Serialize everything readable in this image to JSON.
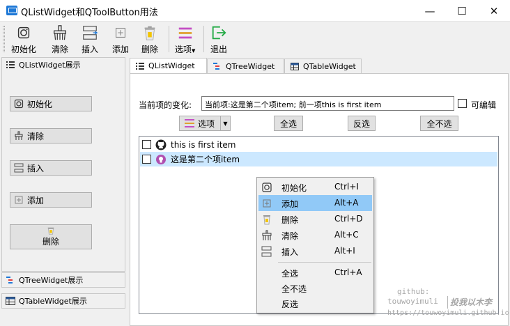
{
  "window": {
    "title": "QListWidget和QToolButton用法",
    "minimize": "—",
    "maximize": "☐",
    "close": "✕"
  },
  "toolbar": {
    "init": "初始化",
    "clear": "清除",
    "insert": "插入",
    "add": "添加",
    "delete": "删除",
    "options": "选项",
    "exit": "退出"
  },
  "dock": {
    "list_title": "QListWidget展示",
    "tree_title": "QTreeWidget展示",
    "table_title": "QTableWidget展示",
    "buttons": {
      "init": "初始化",
      "clear": "清除",
      "insert": "插入",
      "add": "添加",
      "delete": "删除"
    }
  },
  "tabs": [
    {
      "label": "QListWidget"
    },
    {
      "label": "QTreeWidget"
    },
    {
      "label": "QTableWidget"
    }
  ],
  "list_page": {
    "current_label": "当前项的变化:",
    "current_value": "当前项:这是第二个项item;   前一项this is first item",
    "editable_label": "可编辑",
    "options_button": "选项",
    "select_all": "全选",
    "invert": "反选",
    "select_none": "全不选",
    "items": [
      {
        "text": "this is first item",
        "icon": "github-icon",
        "checked": false,
        "selected": false
      },
      {
        "text": "这是第二个项item",
        "icon": "github-purple-icon",
        "checked": false,
        "selected": true
      }
    ]
  },
  "context_menu": {
    "items": [
      {
        "label": "初始化",
        "shortcut": "Ctrl+I",
        "icon": "init-icon"
      },
      {
        "label": "添加",
        "shortcut": "Alt+A",
        "icon": "add-icon",
        "highlighted": true
      },
      {
        "label": "删除",
        "shortcut": "Ctrl+D",
        "icon": "delete-icon"
      },
      {
        "label": "清除",
        "shortcut": "Alt+C",
        "icon": "clear-icon"
      },
      {
        "label": "插入",
        "shortcut": "Alt+I",
        "icon": "insert-icon"
      }
    ],
    "items2": [
      {
        "label": "全选",
        "shortcut": "Ctrl+A"
      },
      {
        "label": "全不选",
        "shortcut": ""
      },
      {
        "label": "反选",
        "shortcut": ""
      }
    ]
  },
  "watermark": {
    "line1": "github:",
    "line2": "touwoyimuli",
    "line3": "https://touwoyimuli.github.io",
    "sign": "投我以木李"
  },
  "colors": {
    "accent": "#1e78d6",
    "selection": "#cce8ff",
    "menu_highlight": "#91c9f7"
  }
}
